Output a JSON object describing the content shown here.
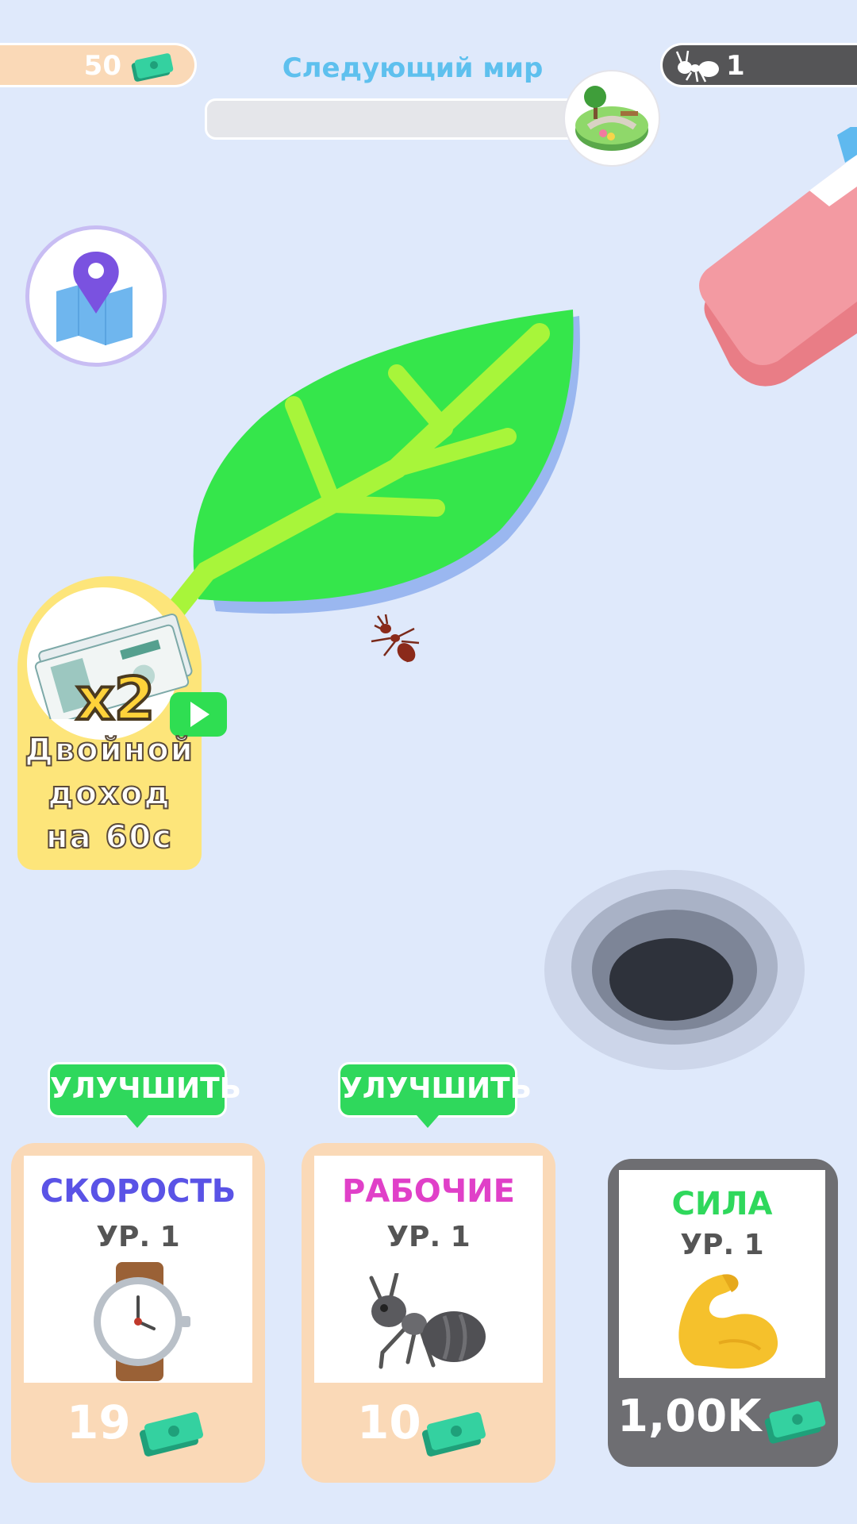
{
  "hud": {
    "money": "50",
    "next_world_label": "Следующий мир",
    "next_world_progress": 0,
    "ants": "1"
  },
  "bonus": {
    "multiplier": "x2",
    "lines": [
      "Двойной",
      "доход",
      "на 60с"
    ]
  },
  "upgrade_label": "УЛУЧШИТЬ",
  "cards": [
    {
      "title": "СКОРОСТЬ",
      "level": "УР. 1",
      "cost": "19",
      "title_color": "#5a53e6",
      "icon": "watch-icon"
    },
    {
      "title": "РАБОЧИЕ",
      "level": "УР. 1",
      "cost": "10",
      "title_color": "#e040c8",
      "icon": "ant-icon"
    },
    {
      "title": "СИЛА",
      "level": "УР. 1",
      "cost": "1,00K",
      "title_color": "#2fd85c",
      "icon": "flexed-biceps-icon"
    }
  ],
  "colors": {
    "background": "#dfe9fb",
    "leaf": "#35e64b",
    "money_green": "#2ec79a"
  }
}
